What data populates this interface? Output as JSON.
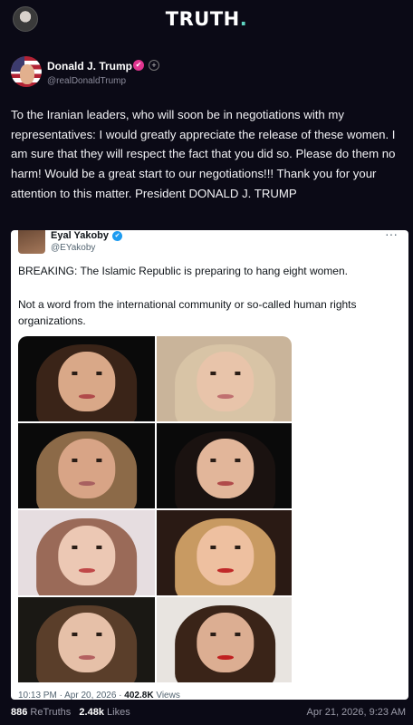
{
  "app": {
    "logo_text": "TRUTH",
    "logo_dot": ".",
    "accent": "#5fd6c2",
    "background": "#0b0a16"
  },
  "post": {
    "author": {
      "name": "Donald J. Trump",
      "handle": "@realDonaldTrump",
      "verified_icon": "verified-badge-icon",
      "follow_icon": "plus-icon"
    },
    "text": "To the Iranian leaders, who will soon be in negotiations with my representatives: I would greatly appreciate the release of these women. I am sure that they will respect the fact that you did so. Please do them no harm! Would be a great start to our negotiations!!! Thank you for your attention to this matter. President DONALD J. TRUMP",
    "quote": {
      "author_name": "Eyal Yakoby",
      "author_handle": "@EYakoby",
      "verified_icon": "blue-check-icon",
      "more_icon": "more-options-icon",
      "label": "BREAKING:",
      "text1_rest": " The Islamic Republic is preparing to hang eight women.",
      "text2": "Not a word from the international community or so-called human rights organizations.",
      "footer_time": "10:13 PM · Apr 20, 2026 · ",
      "footer_views_count": "402.8K",
      "footer_views_label": " Views"
    },
    "stats": {
      "retruths_count": "886",
      "retruths_label": "ReTruths",
      "likes_count": "2.48k",
      "likes_label": "Likes",
      "date": "Apr 21, 2026, 9:23 AM"
    }
  }
}
